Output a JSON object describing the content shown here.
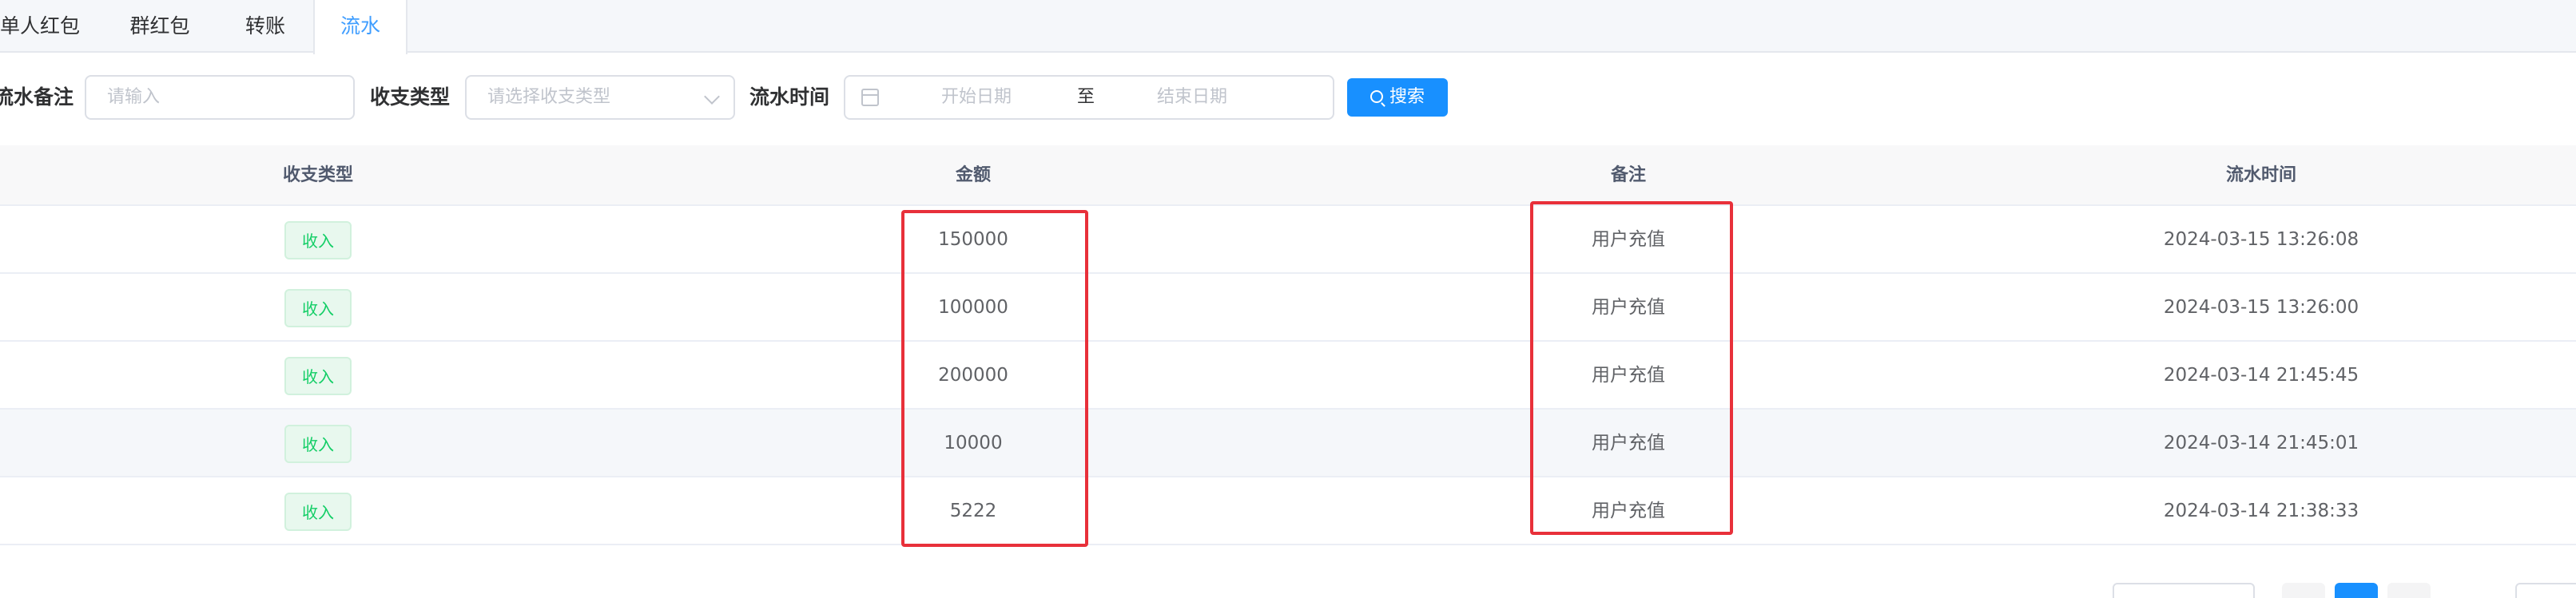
{
  "tabs": [
    "单人红包",
    "群红包",
    "转账",
    "流水"
  ],
  "filters": {
    "remark_label": "流水备注",
    "remark_placeholder": "请输入",
    "type_label": "收支类型",
    "type_placeholder": "请选择收支类型",
    "time_label": "流水时间",
    "start_placeholder": "开始日期",
    "range_sep": "至",
    "end_placeholder": "结束日期",
    "search_label": "搜索"
  },
  "table": {
    "columns": [
      "收支类型",
      "金额",
      "备注",
      "流水时间"
    ],
    "rows": [
      {
        "type": "收入",
        "amount": "150000",
        "remark": "用户充值",
        "time": "2024-03-15 13:26:08"
      },
      {
        "type": "收入",
        "amount": "100000",
        "remark": "用户充值",
        "time": "2024-03-15 13:26:00"
      },
      {
        "type": "收入",
        "amount": "200000",
        "remark": "用户充值",
        "time": "2024-03-14 21:45:45"
      },
      {
        "type": "收入",
        "amount": "10000",
        "remark": "用户充值",
        "time": "2024-03-14 21:45:01"
      },
      {
        "type": "收入",
        "amount": "5222",
        "remark": "用户充值",
        "time": "2024-03-14 21:38:33"
      }
    ]
  },
  "colors": {
    "accent": "#1890ff",
    "tab_active": "#409eff",
    "income_tag": "#13ce66",
    "annotation": "#e8303a"
  }
}
